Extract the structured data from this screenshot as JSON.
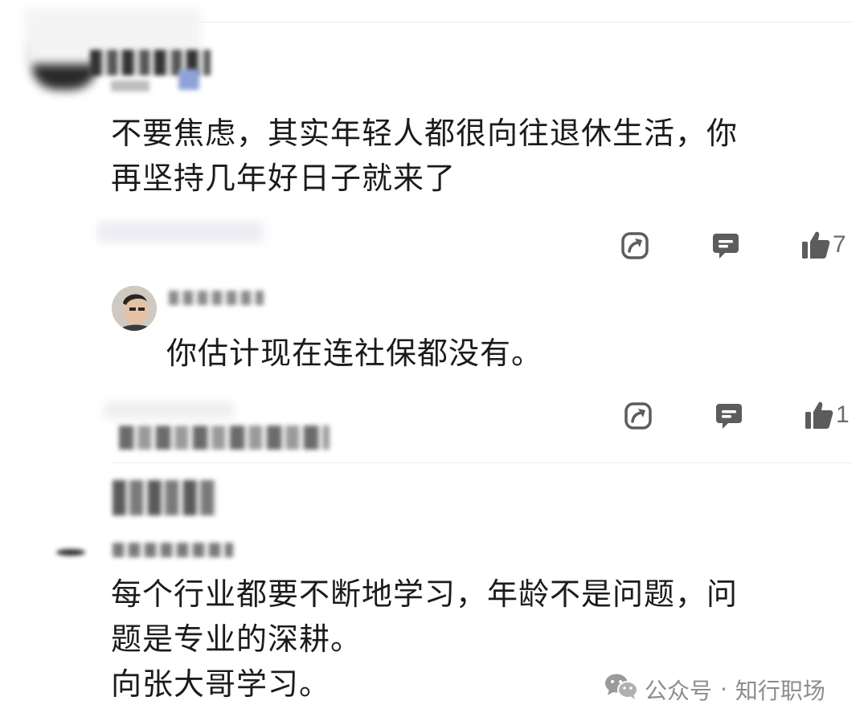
{
  "comments": [
    {
      "text_lines": [
        "不要焦虑，其实年轻人都很向往退休生活，你",
        "再坚持几年好日子就来了"
      ],
      "like_count": "7",
      "reply": {
        "text": "你估计现在连社保都没有。",
        "like_count": "1"
      }
    },
    {
      "text_lines": [
        "每个行业都要不断地学习，年龄不是问题，问",
        "题是专业的深耕。",
        "向张大哥学习。"
      ]
    }
  ],
  "icons": {
    "share": "share-arrow-icon",
    "reply": "comment-bubble-icon",
    "like": "thumbs-up-icon",
    "watermark": "wechat-icon"
  },
  "watermark": {
    "prefix": "公众号",
    "separator": "·",
    "name": "知行职场"
  },
  "colors": {
    "icon": "#5c5c5c",
    "text": "#1b1b1b",
    "muted": "#8c8c8c"
  }
}
